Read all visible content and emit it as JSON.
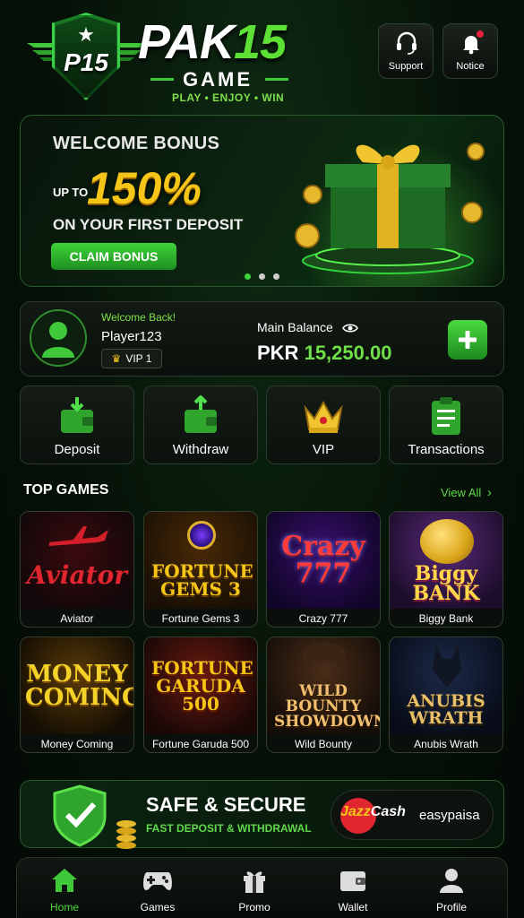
{
  "header": {
    "logo_badge": "P15",
    "brand_main": "PAK",
    "brand_accent": "15",
    "brand_sub": "GAME",
    "tagline": "PLAY • ENJOY • WIN",
    "support_label": "Support",
    "notice_label": "Notice"
  },
  "banner": {
    "title": "WELCOME BONUS",
    "up_to": "UP TO",
    "amount": "150%",
    "subtitle": "ON YOUR FIRST DEPOSIT",
    "cta": "CLAIM BONUS",
    "slide_count": 3,
    "active_slide": 1
  },
  "account": {
    "greeting": "Welcome Back!",
    "username": "Player123",
    "vip_level": "VIP 1",
    "balance_label": "Main Balance",
    "currency": "PKR",
    "balance": "15,250.00"
  },
  "actions": [
    {
      "label": "Deposit",
      "icon": "wallet-deposit-icon"
    },
    {
      "label": "Withdraw",
      "icon": "wallet-withdraw-icon"
    },
    {
      "label": "VIP",
      "icon": "crown-icon"
    },
    {
      "label": "Transactions",
      "icon": "clipboard-icon"
    }
  ],
  "games_section": {
    "title": "TOP GAMES",
    "view_all": "View All",
    "games": [
      {
        "name": "Aviator",
        "art": "Aviator"
      },
      {
        "name": "Fortune Gems 3",
        "art": "FORTUNE GEMS 3"
      },
      {
        "name": "Crazy 777",
        "art": "Crazy 777"
      },
      {
        "name": "Biggy Bank",
        "art": "Biggy BANK"
      },
      {
        "name": "Money Coming",
        "art": "MONEY COMING"
      },
      {
        "name": "Fortune Garuda 500",
        "art": "FORTUNE GARUDA 500"
      },
      {
        "name": "Wild Bounty Showdown",
        "art": "WILD BOUNTY SHOWDOWN"
      },
      {
        "name": "Anubis Wrath",
        "art": "ANUBIS WRATH"
      }
    ]
  },
  "secure": {
    "title": "SAFE & SECURE",
    "subtitle": "FAST DEPOSIT & WITHDRAWAL",
    "jazz_a": "Jazz",
    "jazz_b": "Cash",
    "easypaisa": "easypaisa"
  },
  "nav": [
    {
      "label": "Home",
      "icon": "home-icon",
      "active": true
    },
    {
      "label": "Games",
      "icon": "gamepad-icon",
      "active": false
    },
    {
      "label": "Promo",
      "icon": "gift-icon",
      "active": false
    },
    {
      "label": "Wallet",
      "icon": "wallet-icon",
      "active": false
    },
    {
      "label": "Profile",
      "icon": "profile-icon",
      "active": false
    }
  ],
  "colors": {
    "accent": "#4fd83e",
    "gold": "#f5c518",
    "background": "#061208"
  }
}
